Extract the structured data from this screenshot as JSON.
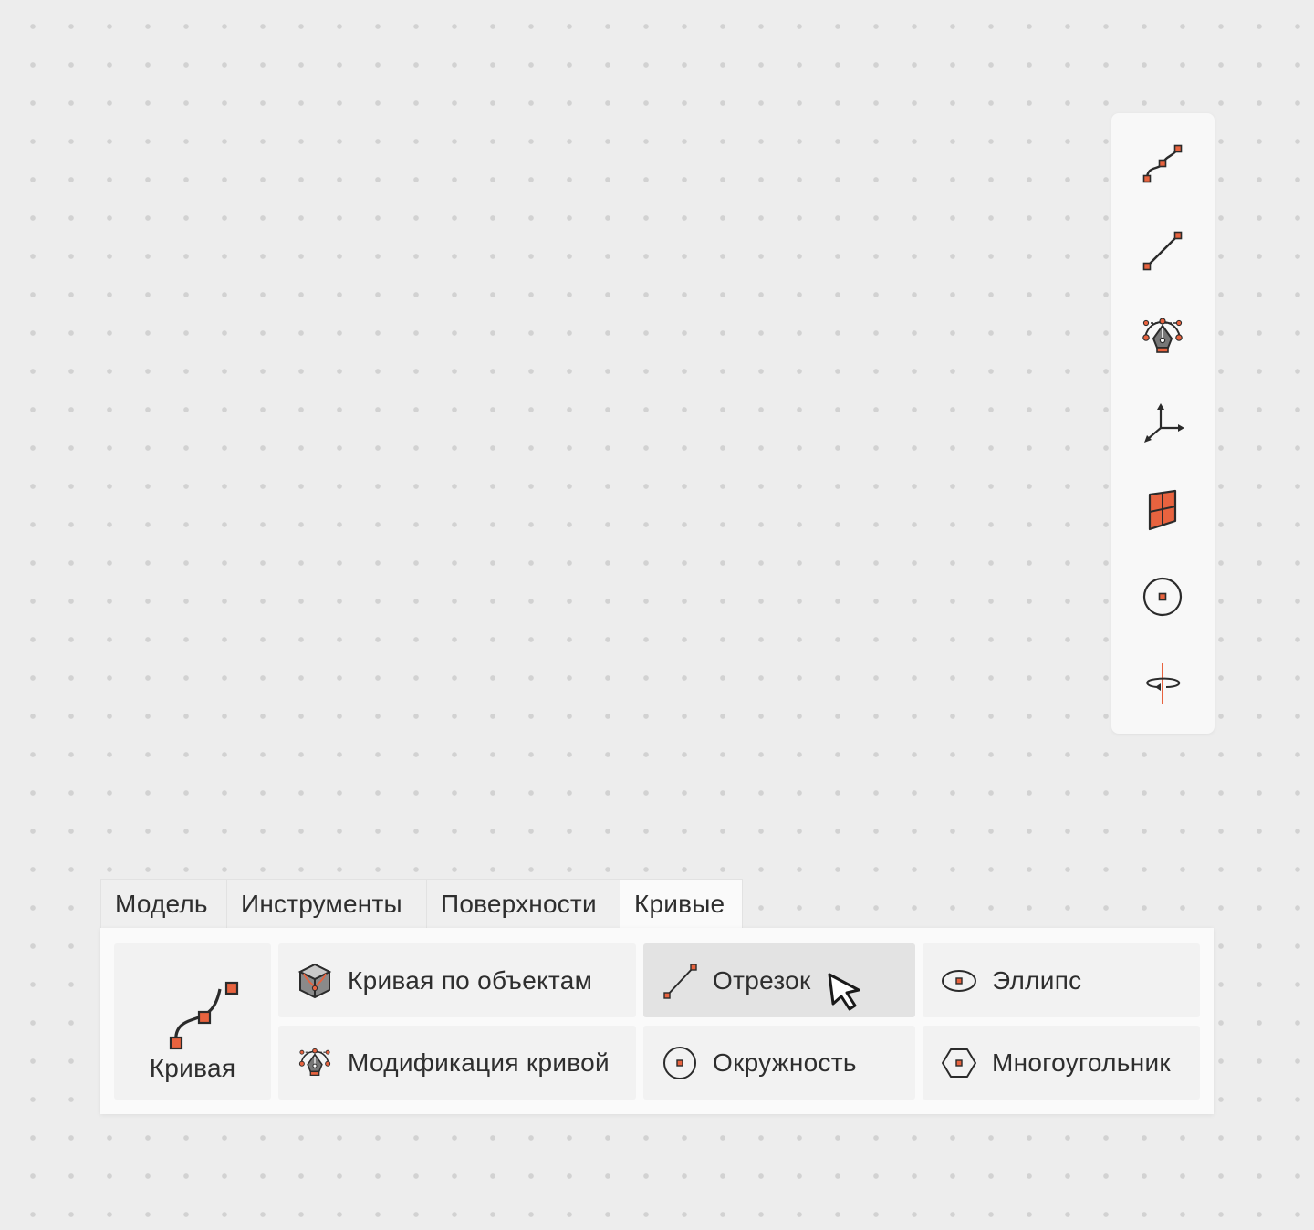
{
  "colors": {
    "accent": "#e8633f",
    "ink": "#2b2b2b",
    "hover": "#e3e3e3"
  },
  "side_toolbar": {
    "buttons": [
      {
        "icon": "curve-icon"
      },
      {
        "icon": "segment-icon"
      },
      {
        "icon": "curve-modify-icon"
      },
      {
        "icon": "axes-icon"
      },
      {
        "icon": "surface-patch-icon"
      },
      {
        "icon": "circle-icon"
      },
      {
        "icon": "rotate-axis-icon"
      }
    ]
  },
  "ribbon": {
    "tabs": [
      "Модель",
      "Инструменты",
      "Поверхности",
      "Кривые"
    ],
    "active_tab": "Кривые",
    "big_button": {
      "label": "Кривая",
      "icon": "curve-icon"
    },
    "buttons": {
      "curve_by_objects": {
        "label": "Кривая по объектам",
        "icon": "cube-icon"
      },
      "curve_modify": {
        "label": "Модификация кривой",
        "icon": "curve-modify-icon"
      },
      "segment": {
        "label": "Отрезок",
        "icon": "segment-icon",
        "hovered": true
      },
      "circle": {
        "label": "Окружность",
        "icon": "circle-icon"
      },
      "ellipse": {
        "label": "Эллипс",
        "icon": "ellipse-icon"
      },
      "polygon": {
        "label": "Многоугольник",
        "icon": "hexagon-icon"
      }
    }
  }
}
